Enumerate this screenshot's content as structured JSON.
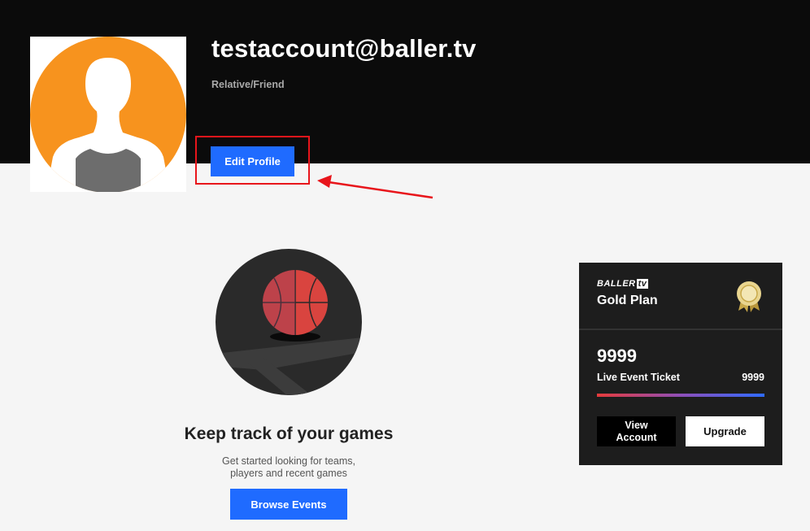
{
  "profile": {
    "email": "testaccount@baller.tv",
    "role": "Relative/Friend",
    "edit_label": "Edit Profile"
  },
  "empty_state": {
    "title": "Keep track of your games",
    "subtitle_line1": "Get started looking for teams,",
    "subtitle_line2": "players and recent games",
    "browse_label": "Browse Events"
  },
  "plan": {
    "brand": "BALLER",
    "brand_tv": "tv",
    "name": "Gold Plan",
    "ticket_count": "9999",
    "ticket_label": "Live Event Ticket",
    "ticket_value": "9999",
    "progress_fraction": 1.0,
    "view_account_line1": "View",
    "view_account_line2": "Account",
    "upgrade_label": "Upgrade"
  },
  "colors": {
    "accent_blue": "#1f6bff",
    "avatar_orange": "#f7931e",
    "annotation_red": "#e8151b",
    "header_bg": "#0b0b0b"
  }
}
